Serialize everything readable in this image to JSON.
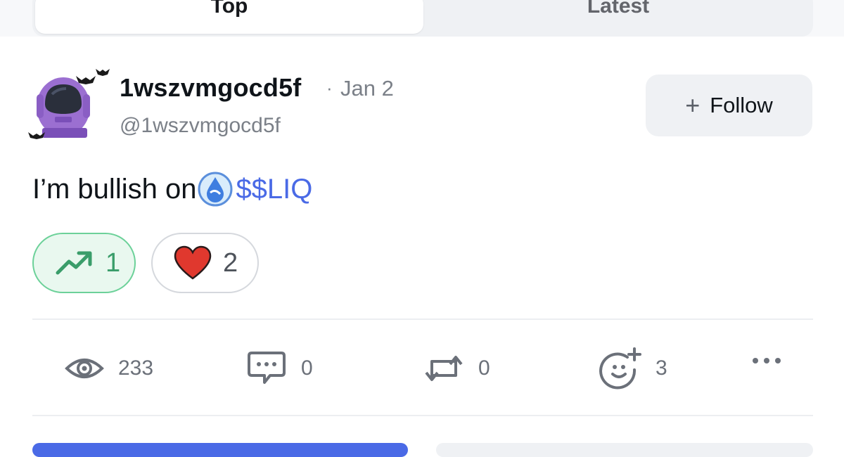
{
  "tabs": [
    {
      "label": "Top"
    },
    {
      "label": "Latest"
    }
  ],
  "post": {
    "author_name": "1wszvmgocd5f",
    "separator": "·",
    "date": "Jan 2",
    "handle": "@1wszvmgocd5f",
    "text_prefix": "I’m bullish on",
    "ticker": "$$LIQ"
  },
  "follow": {
    "plus": "+",
    "label": "Follow"
  },
  "reactions": [
    {
      "icon": "trending-up-icon",
      "count": "1"
    },
    {
      "icon": "heart-icon",
      "count": "2"
    }
  ],
  "actions": {
    "views": "233",
    "comments": "0",
    "reposts": "0",
    "react": "3"
  },
  "colors": {
    "accent": "#4a6ae6",
    "trend_green": "#3a9d6a",
    "heart_red": "#e0382e",
    "avatar_purple": "#9b6fd1"
  }
}
